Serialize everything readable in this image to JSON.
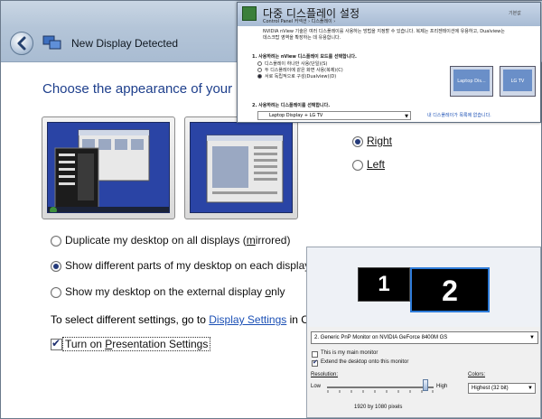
{
  "main_window": {
    "title": "New Display Detected",
    "heading": "Choose the appearance of your",
    "position_options": {
      "right": "Right",
      "left": "Left",
      "selected": "right"
    },
    "display_options": [
      {
        "label_pre": "Duplicate my desktop on all displays (",
        "label_u": "m",
        "label_post": "irrored)",
        "selected": false
      },
      {
        "label_pre": "Show different parts of my desktop on each display",
        "label_u": "",
        "label_post": "",
        "selected": true
      },
      {
        "label_pre": "Show my desktop on the external display ",
        "label_u": "o",
        "label_post": "nly",
        "selected": false
      }
    ],
    "settings_prefix": "To select different settings, go to ",
    "settings_link": "Display Settings",
    "settings_suffix": " in Co",
    "presentation_checkbox": {
      "label_pre": "Turn on ",
      "label_u": "P",
      "label_post": "resentation Settings",
      "checked": true
    }
  },
  "nvidia_dialog": {
    "title": "다중 디스플레이 설정",
    "breadcrumb": "Control Panel 커넥션 › 디스플레이 ›",
    "top_right": "기본값",
    "description_line1": "NVIDIA nView 기술은 여러 디스플레이를 사용하는 방법을 지정할 수 있습니다. 복제는 프리젠테이션에 유용하고, Dualview는",
    "description_line2": "데스크탑 영역을 확장하는 데 유용합니다.",
    "step1": "1. 사용하려는 nView 디스플레이 모드를 선택합니다.",
    "mode_options": [
      "디스플레이 하나만 사용(단일)(S)",
      "두 디스플레이에 같은 화면 사용(복제)(C)",
      "서로 독립적으로 구성(Dualview)(D)"
    ],
    "step2": "2. 사용하려는 디스플레이를 선택합니다.",
    "display_select": "Laptop Display + LG TV",
    "note": "내 디스플레이가 목록에 없습니다.",
    "monitor_labels": [
      "Laptop Dis...",
      "LG TV"
    ]
  },
  "display_settings": {
    "monitors": [
      "1",
      "2"
    ],
    "selected_monitor": "2",
    "monitor_select": "2. Generic PnP Monitor on NVIDIA GeForce 8400M GS",
    "main_monitor_check": {
      "label": "This is my main monitor",
      "checked": false
    },
    "extend_check": {
      "label": "Extend the desktop onto this monitor",
      "checked": true
    },
    "resolution_label": "Resolution:",
    "low_label": "Low",
    "high_label": "High",
    "resolution_value": "1920 by 1080 pixels",
    "resolution_slider_level": 0.92,
    "colors_label": "Colors:",
    "colors_value": "Highest (32 bit)"
  }
}
